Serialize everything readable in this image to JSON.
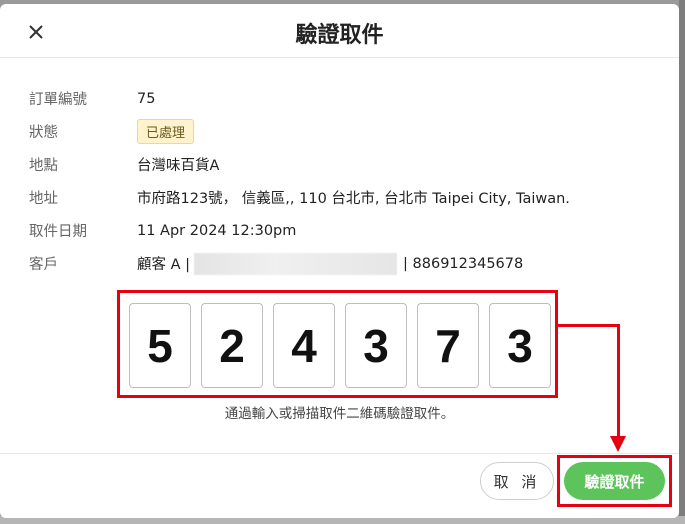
{
  "modal": {
    "title": "驗證取件",
    "close_icon": "close-icon"
  },
  "info": [
    {
      "label": "訂單編號",
      "value": "75"
    },
    {
      "label": "狀態",
      "value": "已處理"
    },
    {
      "label": "地點",
      "value": "台灣味百貨A"
    },
    {
      "label": "地址",
      "value": "市府路123號， 信義區,, 110 台北市, 台北市 Taipei City, Taiwan."
    },
    {
      "label": "取件日期",
      "value": "11 Apr 2024 12:30pm"
    },
    {
      "label": "客戶",
      "value_prefix": "顧客 A |",
      "value_suffix": "| 886912345678"
    }
  ],
  "code": {
    "digits": [
      "5",
      "2",
      "4",
      "3",
      "7",
      "3"
    ],
    "hint": "通過輸入或掃描取件二維碼驗證取件。"
  },
  "footer": {
    "cancel_label": "取 消",
    "confirm_label": "驗證取件"
  },
  "colors": {
    "annotation_red": "#e60012",
    "confirm_green": "#5cc45a",
    "badge_bg": "#fff3cd"
  }
}
